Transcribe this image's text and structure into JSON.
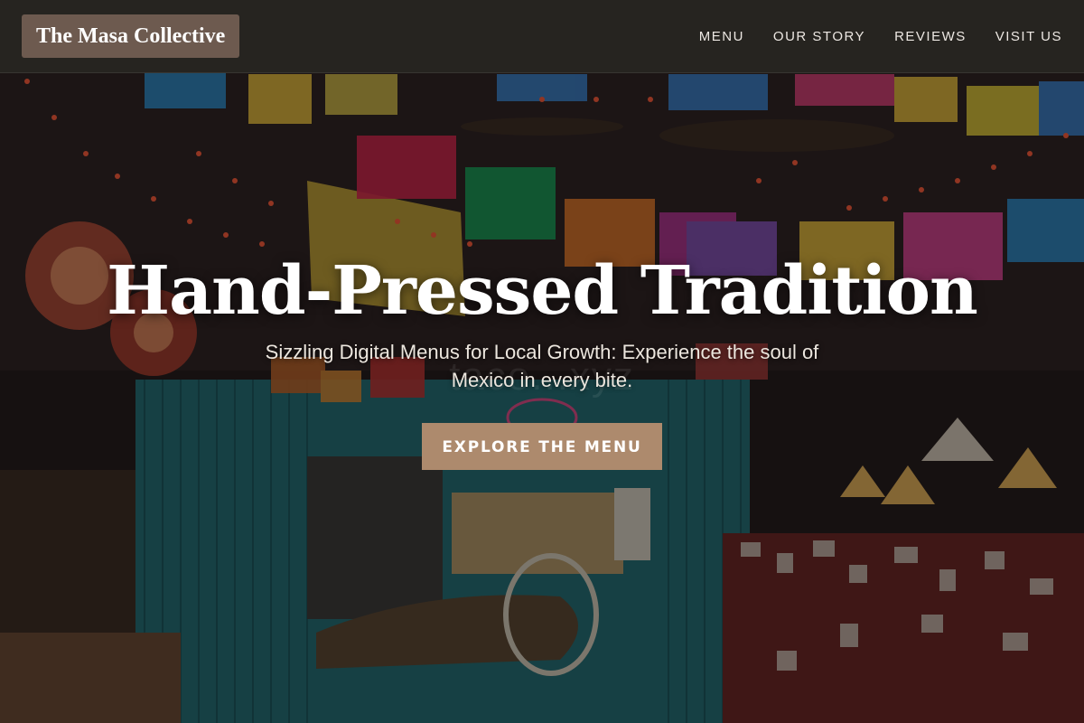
{
  "site": {
    "brand": "The Masa Collective"
  },
  "nav": {
    "items": [
      {
        "label": "MENU"
      },
      {
        "label": "OUR STORY"
      },
      {
        "label": "REVIEWS"
      },
      {
        "label": "VISIT US"
      }
    ]
  },
  "hero": {
    "title": "Hand-Pressed Tradition",
    "subtitle": "Sizzling Digital Menus for Local Growth: Experience the soul of Mexico in every bite.",
    "cta_label": "EXPLORE THE MENU",
    "background_description_icon": "restaurant-interior-image",
    "watermark": "taco...xyz"
  },
  "colors": {
    "header_bg": "#28261f",
    "brand_bg": "#6d5a4f",
    "cta_bg": "#ad8a6d",
    "teal_wall": "#1e6f78",
    "text_light": "#ffffff"
  }
}
